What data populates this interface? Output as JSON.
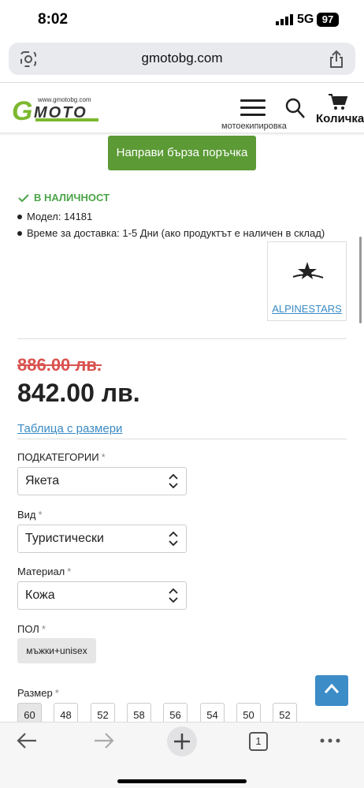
{
  "status_bar": {
    "time": "8:02",
    "network": "5G",
    "battery": "97"
  },
  "browser": {
    "url": "gmotobg.com",
    "tabs_count": "1"
  },
  "site": {
    "logo_url_text": "www.gmotobg.com",
    "logo_g": "G",
    "logo_text": "MOTO",
    "menu_label": "мотоекипировка",
    "cart_label": "Количка"
  },
  "product": {
    "quick_order_label": "Направи бърза поръчка",
    "stock_status": "В НАЛИЧНОСТ",
    "model": "Модел: 14181",
    "delivery": "Време за доставка: 1-5 Дни (ако продуктът е наличен в склад)",
    "brand": "ALPINESTARS",
    "old_price": "886.00 лв.",
    "price": "842.00 лв.",
    "size_table_link": "Таблица с размери"
  },
  "options": {
    "subcategory": {
      "label": "ПОДКАТЕГОРИИ",
      "value": "Якета"
    },
    "type": {
      "label": "Вид",
      "value": "Туристически"
    },
    "material": {
      "label": "Материал",
      "value": "Кожа"
    },
    "gender": {
      "label": "ПОЛ",
      "value": "мъжки+unisex"
    },
    "size": {
      "label": "Размер",
      "values": [
        "60",
        "48",
        "52",
        "58",
        "56",
        "54",
        "50",
        "52"
      ],
      "selected": "60"
    },
    "required_mark": "*"
  },
  "colors": {
    "accent_green": "#5b9a35",
    "stock_green": "#4ca449",
    "link_blue": "#3a8bc5",
    "old_price_red": "#d9534f"
  }
}
